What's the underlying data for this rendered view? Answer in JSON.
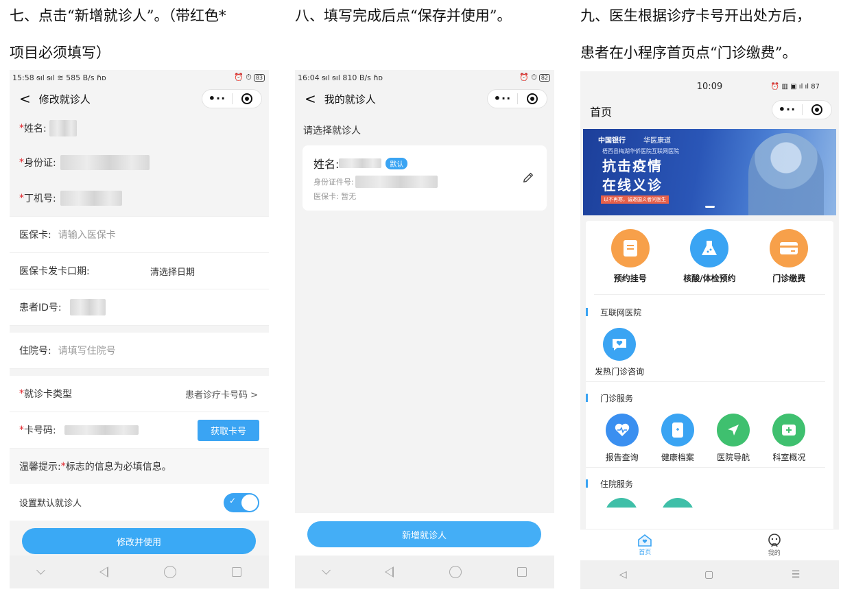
{
  "captions": {
    "step7": [
      "七、点击“新增就诊人”。（带红色*",
      "项目必须填写）"
    ],
    "step8": [
      "八、填写完成后点“保存并使用”。"
    ],
    "step9": [
      "九、医生根据诊疗卡号开出处方后，",
      "患者在小程序首页点“门诊缴费”。"
    ]
  },
  "phone1": {
    "status_left": "15:58 ᵴıl ᵴıl ≋ 585 B/s ɦᴅ",
    "status_right": "⏰ ⏱",
    "battery": "83",
    "back": "<",
    "title": "修改就诊人",
    "capsule_dots": "•··",
    "fields": {
      "name_label": "姓名:",
      "id_label": "身份证:",
      "phone_label": "丁机号:",
      "medcard_label": "医保卡:",
      "medcard_placeholder": "请输入医保卡",
      "issue_label": "医保卡发卡口期:",
      "issue_value": "清选择日期",
      "pid_label": "患者ID号:",
      "inpatient_label": "住院号:",
      "inpatient_placeholder": "请填写住院号",
      "cardtype_label": "就诊卡类型",
      "cardtype_value": "患者诊疗卡号码 >",
      "cardno_label": "卡号码:",
      "get_card_button": "获取卡号"
    },
    "required_mark": "*",
    "tip_prefix": "温馨提示:",
    "tip_mark": "*",
    "tip_rest": "标志的信息为必填信息。",
    "default_label": "设置默认就诊人",
    "toggle_check": "✓",
    "submit_button": "修改并使用"
  },
  "phone2": {
    "status_left": "16:04 ᵴıl ᵴıl 810 B/s ɦᴅ",
    "status_right": "⏰ ⏱",
    "battery": "82",
    "back": "<",
    "title": "我的就诊人",
    "capsule_dots": "•··",
    "select_label": "请选择就诊人",
    "card": {
      "name_label": "姓名:",
      "badge": "默认",
      "id_label": "身份证件号:",
      "medcard": "医保卡: 暂无"
    },
    "add_button": "新增就诊人"
  },
  "phone3": {
    "time": "10:09",
    "battery": "87",
    "title": "首页",
    "capsule_dots": "•··",
    "banner": {
      "logo1": "中国银行",
      "logo2": "华医康道",
      "subtitle": "梧西县梅湖华侨医院互联网医院",
      "line1": "抗击疫情",
      "line2": "在线义诊",
      "tag": "以不再寒，诚邀国义者问医生"
    },
    "top_services": [
      {
        "label": "预约挂号",
        "color": "#f7a04a"
      },
      {
        "label": "核酸/体检预约",
        "color": "#3aa4f3"
      },
      {
        "label": "门诊缴费",
        "color": "#f7a04a"
      }
    ],
    "sections": {
      "internet": "互联网医院",
      "outpatient": "门诊服务",
      "inpatient": "住院服务"
    },
    "fever": {
      "label": "发热门诊咨询",
      "color": "#3aa4f3"
    },
    "outpatient_services": [
      {
        "label": "报告查询",
        "color": "#3a8ff0"
      },
      {
        "label": "健康档案",
        "color": "#3aa4f3"
      },
      {
        "label": "医院导航",
        "color": "#3fc06f"
      },
      {
        "label": "科室概况",
        "color": "#3fc06f"
      }
    ],
    "tabs": [
      {
        "label": "首页"
      },
      {
        "label": "我的"
      }
    ],
    "sys": [
      "◁",
      "▢",
      "☰"
    ]
  }
}
